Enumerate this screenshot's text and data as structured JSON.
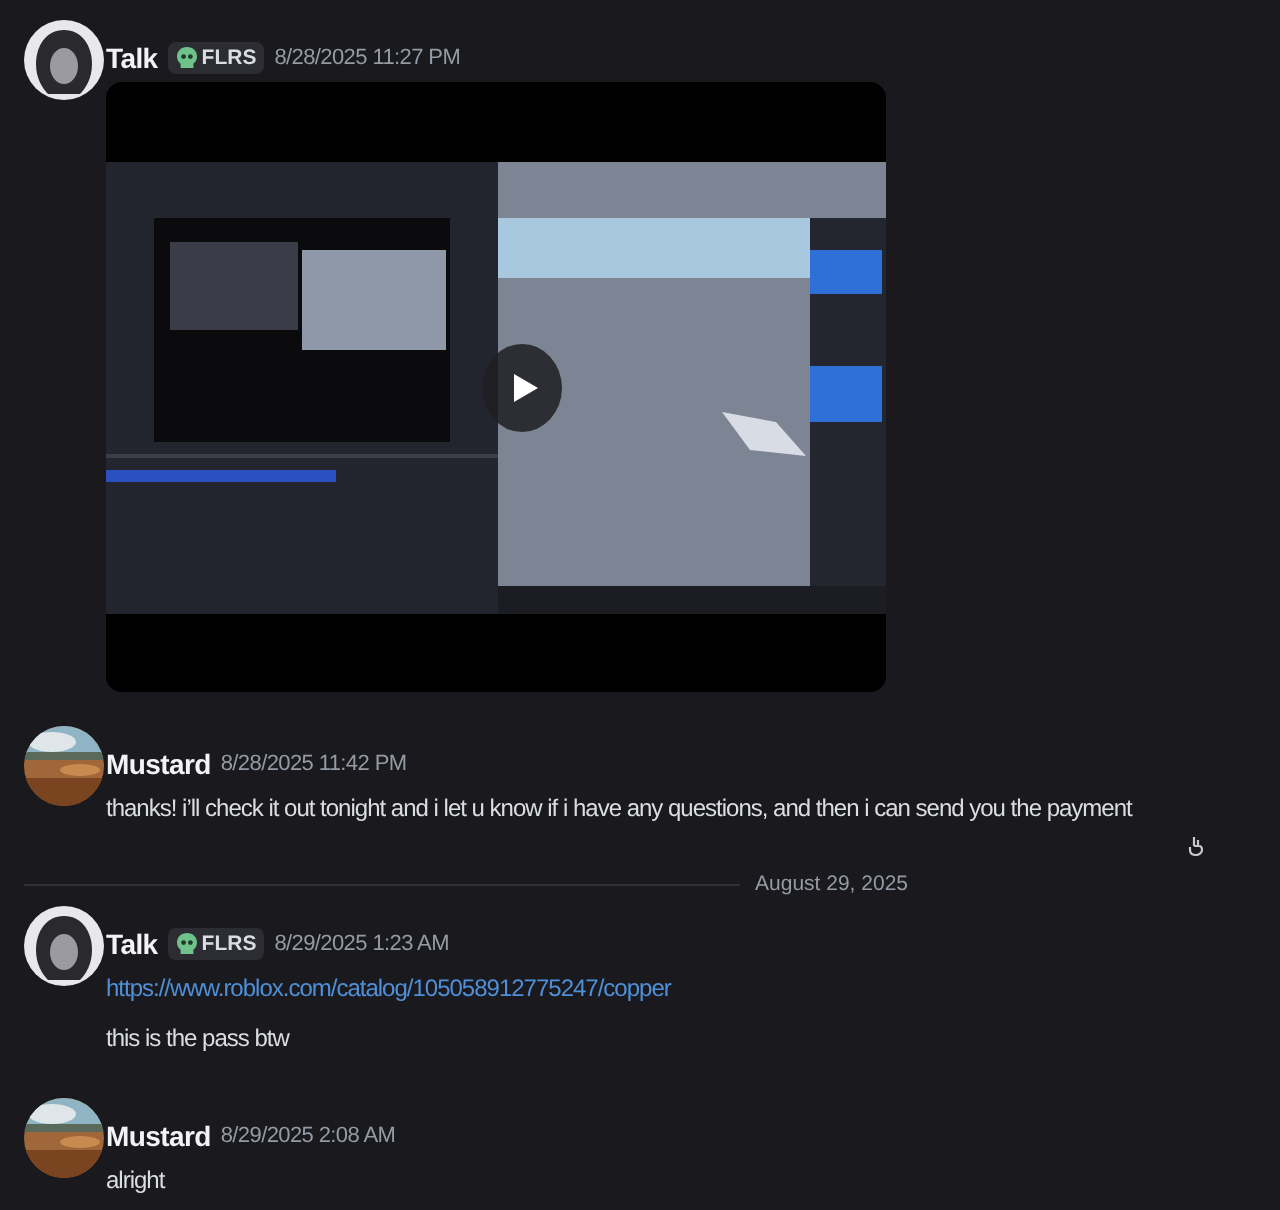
{
  "messages": [
    {
      "kind": "message",
      "author": "Talk",
      "avatar": {
        "kind": "silhouette"
      },
      "tag": "FLRS",
      "time": "8/28/2025 11:27 PM",
      "attachment": {
        "kind": "video"
      }
    },
    {
      "kind": "message",
      "author": "Mustard",
      "avatar": {
        "kind": "picture"
      },
      "time": "8/28/2025 11:42 PM",
      "lines": [
        {
          "kind": "text",
          "text": "thanks! i’ll check it out tonight and i  let u know if i have any questions, and then i can send you the payment"
        }
      ],
      "hover_icon": true
    },
    {
      "kind": "divider",
      "label": "August 29, 2025"
    },
    {
      "kind": "message",
      "author": "Talk",
      "avatar": {
        "kind": "silhouette"
      },
      "tag": "FLRS",
      "time": "8/29/2025 1:23 AM",
      "lines": [
        {
          "kind": "link",
          "text": "https://www.roblox.com/catalog/105058912775247/copper"
        },
        {
          "kind": "text",
          "text": "this is the pass btw"
        }
      ]
    },
    {
      "kind": "message",
      "author": "Mustard",
      "avatar": {
        "kind": "picture"
      },
      "time": "8/29/2025 2:08 AM",
      "lines": [
        {
          "kind": "text",
          "text": "alright"
        }
      ]
    }
  ]
}
